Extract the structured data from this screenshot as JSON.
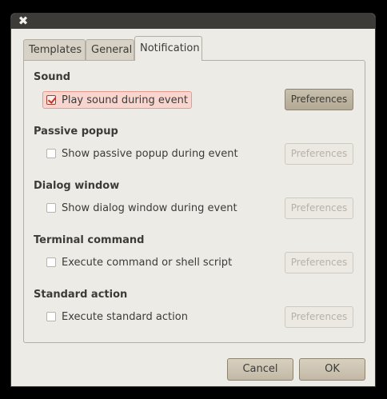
{
  "titlebar": {
    "close_symbol": "✖"
  },
  "tabs": [
    {
      "label": "Templates"
    },
    {
      "label": "General"
    },
    {
      "label": "Notification"
    }
  ],
  "sections": [
    {
      "title": "Sound",
      "checkbox_label": "Play sound during event",
      "checked": true,
      "button_label": "Preferences",
      "button_enabled": true
    },
    {
      "title": "Passive popup",
      "checkbox_label": "Show passive popup during event",
      "checked": false,
      "button_label": "Preferences",
      "button_enabled": false
    },
    {
      "title": "Dialog window",
      "checkbox_label": "Show dialog window during event",
      "checked": false,
      "button_label": "Preferences",
      "button_enabled": false
    },
    {
      "title": "Terminal command",
      "checkbox_label": "Execute command or shell script",
      "checked": false,
      "button_label": "Preferences",
      "button_enabled": false
    },
    {
      "title": "Standard action",
      "checkbox_label": "Execute standard action",
      "checked": false,
      "button_label": "Preferences",
      "button_enabled": false
    }
  ],
  "footer": {
    "cancel_label": "Cancel",
    "ok_label": "OK"
  }
}
